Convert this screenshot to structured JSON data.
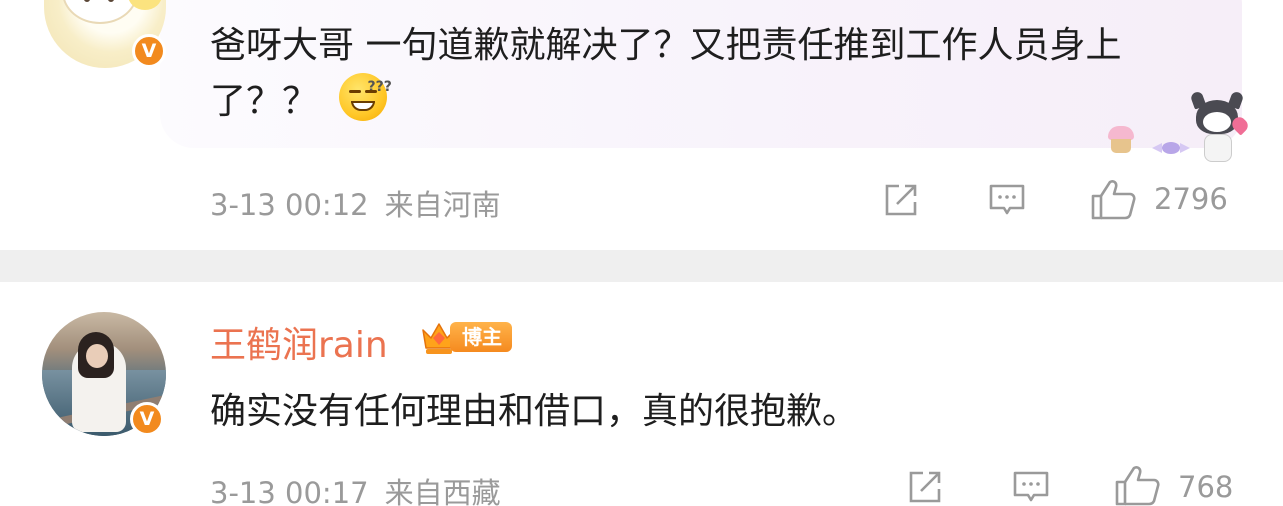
{
  "comments": [
    {
      "avatar_desc": "cartoon-avatar",
      "verified_badge": "V",
      "text": "爸呀大哥 一句道歉就解决了？又把责任推到工作人员身上了？？",
      "emoji": "grinning-sweat-emoji",
      "time": "3-13 00:12",
      "location": "来自河南",
      "likes": "2796"
    },
    {
      "avatar_desc": "photo-avatar",
      "verified_badge": "V",
      "username": "王鹤润rain",
      "badge_label": "博主",
      "text": "确实没有任何理由和借口，真的很抱歉。",
      "time": "3-13 00:17",
      "location": "来自西藏",
      "likes": "768"
    }
  ],
  "colors": {
    "username": "#eb7350",
    "meta": "#9a9a9a",
    "badge": "#f28a1e",
    "band": "#efefef"
  },
  "icons": [
    "share-icon",
    "comment-icon",
    "like-icon"
  ]
}
